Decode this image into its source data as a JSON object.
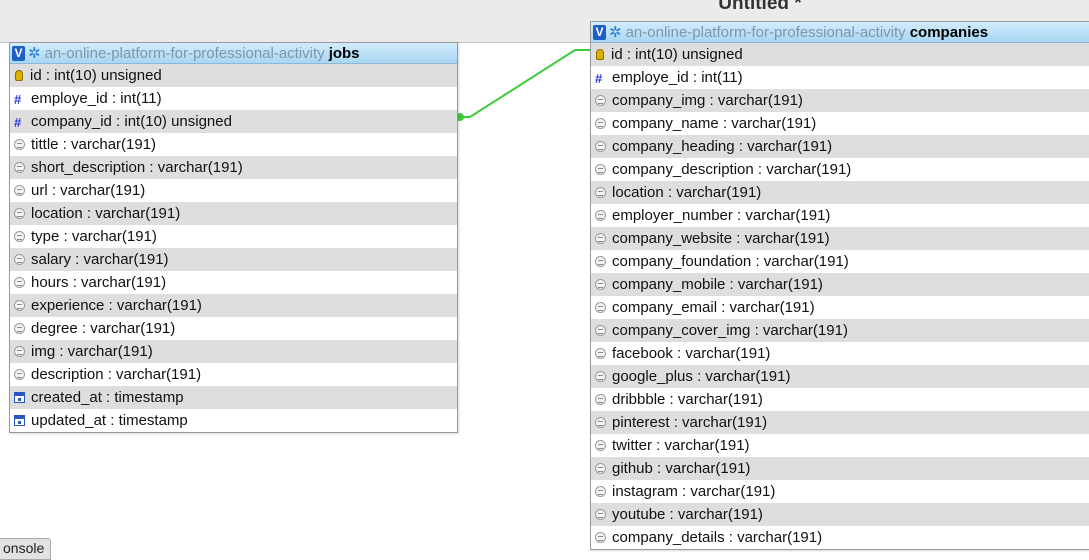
{
  "canvas": {
    "title": "Untitled *"
  },
  "toggle_label": "V",
  "colors": {
    "relation_line": "#3ccc3c",
    "header_grad_top": "#d2ecfb",
    "header_grad_bottom": "#a9d6f3"
  },
  "tables": [
    {
      "db": "an-online-platform-for-professional-activity",
      "name": "jobs",
      "columns": [
        {
          "text": "id : int(10) unsigned",
          "icon": "primary-key-icon"
        },
        {
          "text": "employe_id : int(11)",
          "icon": "numeric-icon"
        },
        {
          "text": "company_id : int(10) unsigned",
          "icon": "numeric-icon"
        },
        {
          "text": "tittle : varchar(191)",
          "icon": "text-icon"
        },
        {
          "text": "short_description : varchar(191)",
          "icon": "text-icon"
        },
        {
          "text": "url : varchar(191)",
          "icon": "text-icon"
        },
        {
          "text": "location : varchar(191)",
          "icon": "text-icon"
        },
        {
          "text": "type : varchar(191)",
          "icon": "text-icon"
        },
        {
          "text": "salary : varchar(191)",
          "icon": "text-icon"
        },
        {
          "text": "hours : varchar(191)",
          "icon": "text-icon"
        },
        {
          "text": "experience : varchar(191)",
          "icon": "text-icon"
        },
        {
          "text": "degree : varchar(191)",
          "icon": "text-icon"
        },
        {
          "text": "img : varchar(191)",
          "icon": "text-icon"
        },
        {
          "text": "description : varchar(191)",
          "icon": "text-icon"
        },
        {
          "text": "created_at : timestamp",
          "icon": "timestamp-icon"
        },
        {
          "text": "updated_at : timestamp",
          "icon": "timestamp-icon"
        }
      ]
    },
    {
      "db": "an-online-platform-for-professional-activity",
      "name": "companies",
      "columns": [
        {
          "text": "id : int(10) unsigned",
          "icon": "primary-key-icon"
        },
        {
          "text": "employe_id : int(11)",
          "icon": "numeric-icon"
        },
        {
          "text": "company_img : varchar(191)",
          "icon": "text-icon"
        },
        {
          "text": "company_name : varchar(191)",
          "icon": "text-icon"
        },
        {
          "text": "company_heading : varchar(191)",
          "icon": "text-icon"
        },
        {
          "text": "company_description : varchar(191)",
          "icon": "text-icon"
        },
        {
          "text": "location : varchar(191)",
          "icon": "text-icon"
        },
        {
          "text": "employer_number : varchar(191)",
          "icon": "text-icon"
        },
        {
          "text": "company_website : varchar(191)",
          "icon": "text-icon"
        },
        {
          "text": "company_foundation : varchar(191)",
          "icon": "text-icon"
        },
        {
          "text": "company_mobile : varchar(191)",
          "icon": "text-icon"
        },
        {
          "text": "company_email : varchar(191)",
          "icon": "text-icon"
        },
        {
          "text": "company_cover_img : varchar(191)",
          "icon": "text-icon"
        },
        {
          "text": "facebook : varchar(191)",
          "icon": "text-icon"
        },
        {
          "text": "google_plus : varchar(191)",
          "icon": "text-icon"
        },
        {
          "text": "dribbble : varchar(191)",
          "icon": "text-icon"
        },
        {
          "text": "pinterest : varchar(191)",
          "icon": "text-icon"
        },
        {
          "text": "twitter : varchar(191)",
          "icon": "text-icon"
        },
        {
          "text": "github : varchar(191)",
          "icon": "text-icon"
        },
        {
          "text": "instagram : varchar(191)",
          "icon": "text-icon"
        },
        {
          "text": "youtube : varchar(191)",
          "icon": "text-icon"
        },
        {
          "text": "company_details : varchar(191)",
          "icon": "text-icon"
        }
      ]
    }
  ],
  "console": {
    "label": "onsole"
  }
}
